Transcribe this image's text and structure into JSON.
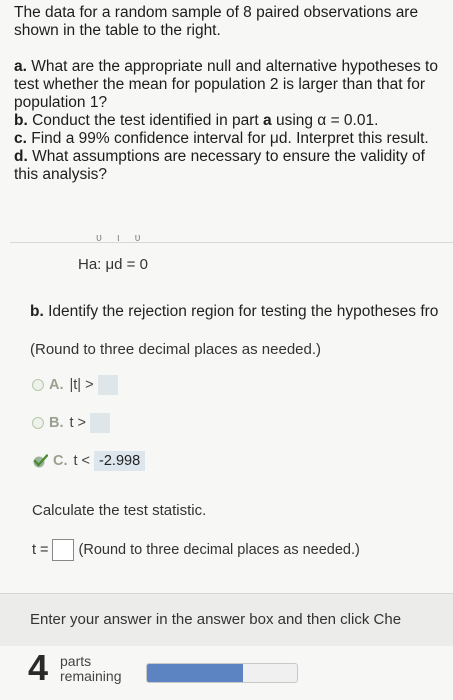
{
  "problem": {
    "intro": "The data for a random sample of 8 paired observations are shown in the table to the right.",
    "a_label": "a.",
    "a_text": "What are the appropriate null and alternative hypotheses to test whether the mean for population 2 is larger than that for population 1?",
    "b_label": "b.",
    "b_text_pre": "Conduct the test identified in part ",
    "b_part": "a",
    "b_text_post": " using α = 0.01.",
    "c_label": "c.",
    "c_text": "Find a 99% confidence interval for μd. Interpret this result.",
    "d_label": "d.",
    "d_text": "What assumptions are necessary to ensure the validity of this analysis?"
  },
  "hypothesis": {
    "fragment": "ʋ ι ʋ",
    "alt": "Ha: μd = 0"
  },
  "part_b": {
    "label": "b.",
    "instruction": "Identify the rejection region for testing the hypotheses fro",
    "round_note": "(Round to three decimal places as needed.)",
    "options": [
      {
        "letter": "A.",
        "expr": "|t| >",
        "value": "",
        "selected": false
      },
      {
        "letter": "B.",
        "expr": "t >",
        "value": "",
        "selected": false
      },
      {
        "letter": "C.",
        "expr": "t <",
        "value": "-2.998",
        "selected": true
      }
    ]
  },
  "test_stat": {
    "prompt": "Calculate the test statistic.",
    "label": "t =",
    "input_value": "",
    "round_note": "(Round to three decimal places as needed.)"
  },
  "footer": {
    "instruction": "Enter your answer in the answer box and then click Che"
  },
  "progress": {
    "parts_count": "4",
    "parts_label_1": "parts",
    "parts_label_2": "remaining",
    "completed_fraction": 0.64,
    "fill_color": "#5d84c2"
  }
}
